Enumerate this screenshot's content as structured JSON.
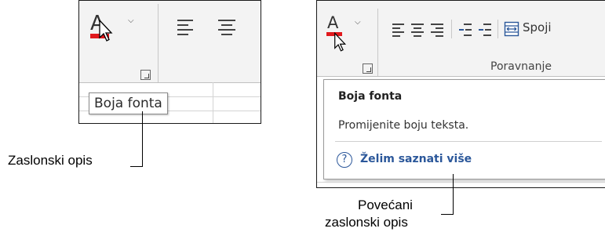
{
  "left_panel": {
    "font_color_letter": "A",
    "tooltip_text": "Boja fonta",
    "caption": "Zaslonski opis"
  },
  "right_panel": {
    "font_color_letter": "A",
    "merge_label": "Spoji",
    "group_label": "Poravnanje",
    "supertip_title": "Boja fonta",
    "supertip_description": "Promijenite boju teksta.",
    "help_link": "Želim saznati više",
    "help_icon_glyph": "?",
    "caption_line1": "Povećani",
    "caption_line2": "zaslonski opis"
  },
  "icons": {
    "font_color": "font-color-icon",
    "dropdown": "chevron-down-icon",
    "cursor": "mouse-pointer-icon",
    "launcher": "dialog-launcher-icon",
    "help": "help-circle-icon",
    "merge": "merge-center-icon"
  },
  "colors": {
    "font_color_bar": "#e0191d",
    "link": "#2b579a",
    "ribbon_bg": "#f3f3f3"
  }
}
